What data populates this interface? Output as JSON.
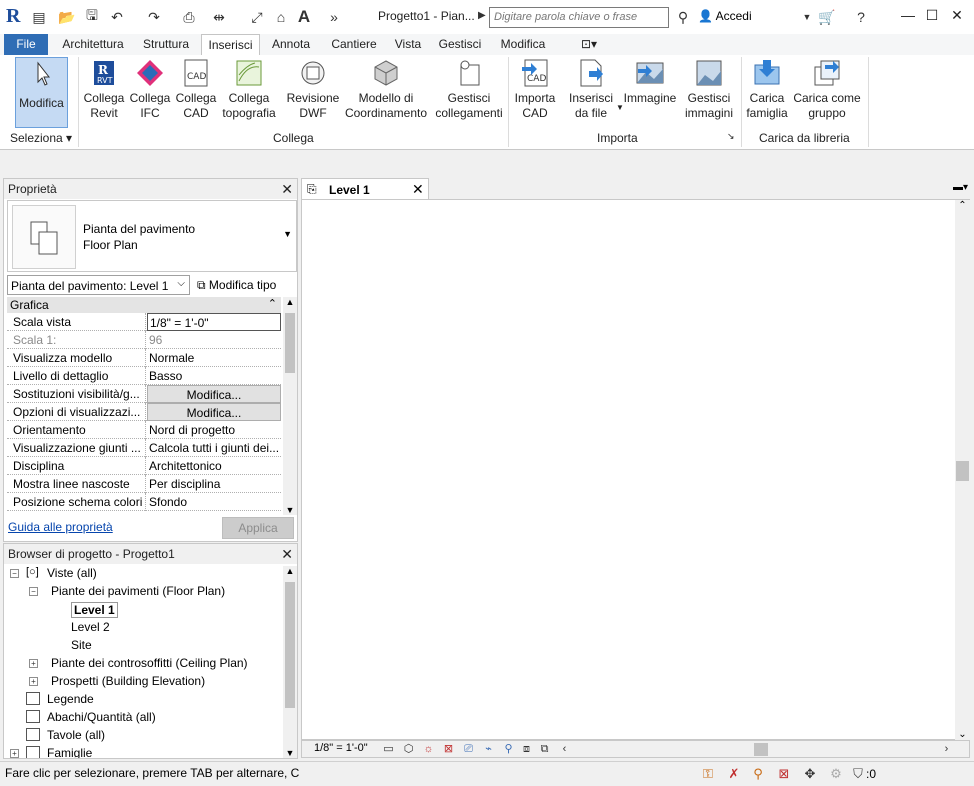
{
  "titlebar": {
    "logo": "R",
    "title": "Progetto1 - Pian...",
    "search_placeholder": "Digitare parola chiave o frase",
    "signin": "Accedi"
  },
  "tabs": [
    "File",
    "Architettura",
    "Struttura",
    "Inserisci",
    "Annota",
    "Cantiere",
    "Vista",
    "Gestisci",
    "Modifica"
  ],
  "ribbon": {
    "select": {
      "l1": "Modifica",
      "group": "Seleziona"
    },
    "link_group": "Collega",
    "link_buttons": [
      {
        "l1": "Collega",
        "l2": "Revit"
      },
      {
        "l1": "Collega",
        "l2": "IFC"
      },
      {
        "l1": "Collega",
        "l2": "CAD"
      },
      {
        "l1": "Collega",
        "l2": "topografia"
      },
      {
        "l1": "Revisione",
        "l2": "DWF"
      },
      {
        "l1": "Modello di",
        "l2": "Coordinamento"
      },
      {
        "l1": "Gestisci",
        "l2": "collegamenti"
      }
    ],
    "import_group": "Importa",
    "import_buttons": [
      {
        "l1": "Importa",
        "l2": "CAD"
      },
      {
        "l1": "Inserisci",
        "l2": "da file"
      },
      {
        "l1": "Immagine",
        "l2": ""
      },
      {
        "l1": "Gestisci",
        "l2": "immagini"
      }
    ],
    "library_group": "Carica da libreria",
    "library_buttons": [
      {
        "l1": "Carica",
        "l2": "famiglia"
      },
      {
        "l1": "Carica come",
        "l2": "gruppo"
      }
    ],
    "colors": {
      "file_tab": "#2f6db5",
      "selected": "#c5daf3"
    }
  },
  "properties": {
    "title": "Proprietà",
    "type_l1": "Pianta del pavimento",
    "type_l2": "Floor Plan",
    "instance_selector": "Pianta del pavimento: Level 1",
    "edit_type": "Modifica tipo",
    "section": "Grafica",
    "rows": [
      {
        "key": "Scala vista",
        "value": "1/8\" = 1'-0\""
      },
      {
        "key": "Scala  1:",
        "value": "96"
      },
      {
        "key": "Visualizza modello",
        "value": "Normale"
      },
      {
        "key": "Livello di dettaglio",
        "value": "Basso"
      },
      {
        "key": "Sostituzioni visibilità/g...",
        "value": "Modifica..."
      },
      {
        "key": "Opzioni di visualizzazi...",
        "value": "Modifica..."
      },
      {
        "key": "Orientamento",
        "value": "Nord di progetto"
      },
      {
        "key": "Visualizzazione giunti ...",
        "value": "Calcola tutti i giunti dei..."
      },
      {
        "key": "Disciplina",
        "value": "Architettonico"
      },
      {
        "key": "Mostra linee nascoste",
        "value": "Per disciplina"
      },
      {
        "key": "Posizione schema colori",
        "value": "Sfondo"
      }
    ],
    "help_link": "Guida alle proprietà",
    "apply": "Applica"
  },
  "browser": {
    "title": "Browser di progetto - Progetto1",
    "views_all": "Viste (all)",
    "floor_plans": "Piante dei pavimenti (Floor Plan)",
    "levels": [
      "Level 1",
      "Level 2",
      "Site"
    ],
    "ceiling_plans": "Piante dei controsoffitti (Ceiling Plan)",
    "elevations": "Prospetti (Building Elevation)",
    "legends": "Legende",
    "schedules": "Abachi/Quantità (all)",
    "sheets": "Tavole (all)",
    "families": "Famiglie"
  },
  "view": {
    "tab_label": "Level 1",
    "scale": "1/8\" = 1'-0\""
  },
  "status": {
    "text": "Fare clic per selezionare, premere TAB per alternare, C",
    "filter_count": ":0"
  }
}
